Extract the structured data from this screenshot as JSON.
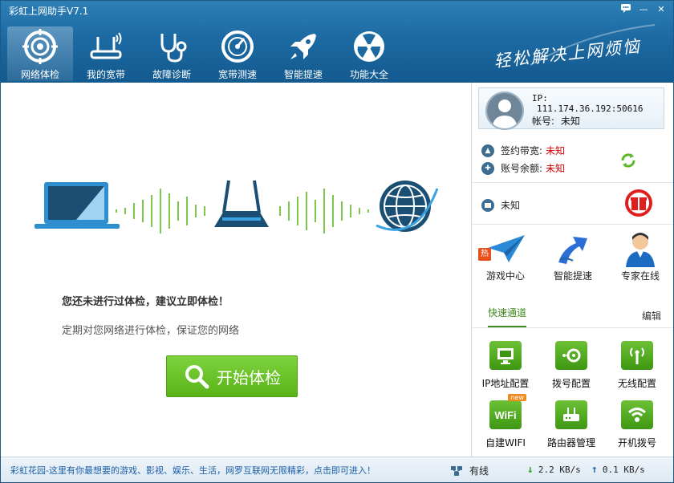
{
  "app": {
    "title": "彩虹上网助手V7.1",
    "slogan": "轻松解决上网烦恼"
  },
  "window_buttons": {
    "chat": "chat-icon",
    "minimize": "—",
    "close": "✕"
  },
  "nav": [
    {
      "label": "网络体检",
      "icon": "target-icon",
      "active": true
    },
    {
      "label": "我的宽带",
      "icon": "router-icon"
    },
    {
      "label": "故障诊断",
      "icon": "stethoscope-icon"
    },
    {
      "label": "宽带测速",
      "icon": "speedometer-icon"
    },
    {
      "label": "智能提速",
      "icon": "rocket-icon"
    },
    {
      "label": "功能大全",
      "icon": "apps-icon"
    }
  ],
  "main": {
    "message_primary": "您还未进行过体检，建议立即体检！",
    "message_secondary": "定期对您网络进行体检，保证您的网络",
    "start_button": "开始体检"
  },
  "user": {
    "ip_label": "IP:",
    "ip_value": "111.174.36.192:50616",
    "account_label": "帐号:",
    "account_value": "未知",
    "bandwidth_label": "签约带宽:",
    "bandwidth_value": "未知",
    "balance_label": "账号余额:",
    "balance_value": "未知",
    "network_value": "未知"
  },
  "quick_services": [
    {
      "label": "游戏中心",
      "icon": "paper-plane-icon",
      "badge": "热"
    },
    {
      "label": "智能提速",
      "icon": "arrow-boost-icon"
    },
    {
      "label": "专家在线",
      "icon": "expert-icon"
    }
  ],
  "tabs": {
    "quick": "快速通道",
    "edit": "编辑"
  },
  "shortcuts": [
    {
      "label": "IP地址配置",
      "icon": "monitor-icon"
    },
    {
      "label": "拨号配置",
      "icon": "dial-icon"
    },
    {
      "label": "无线配置",
      "icon": "antenna-icon"
    },
    {
      "label": "自建WIFI",
      "icon": "wifi-text-icon",
      "badge": "new",
      "tile_text": "WiFi"
    },
    {
      "label": "路由器管理",
      "icon": "router-box-icon"
    },
    {
      "label": "开机拨号",
      "icon": "wifi-icon"
    }
  ],
  "status": {
    "ad_text": "彩虹花园-这里有你最想要的游戏、影视、娱乐、生活，网罗互联网无限精彩，点击即可进入！",
    "connection": "有线",
    "download": "2.2 KB/s",
    "upload": "0.1 KB/s"
  },
  "colors": {
    "header": "#1d6aa3",
    "accent_green": "#58b318",
    "alert_red": "#d20000"
  }
}
